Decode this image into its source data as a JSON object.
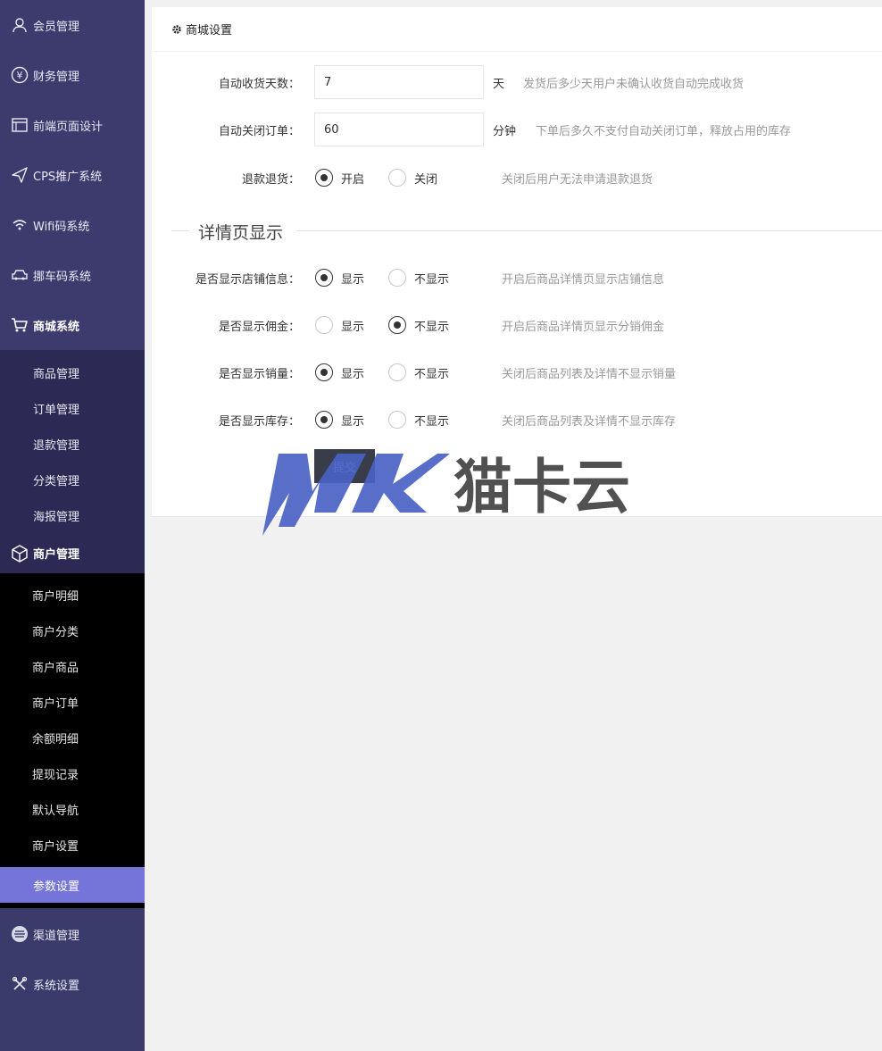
{
  "sidebar": {
    "top_items": [
      {
        "label": "会员管理",
        "icon": "user-icon"
      },
      {
        "label": "财务管理",
        "icon": "yen-icon"
      },
      {
        "label": "前端页面设计",
        "icon": "layout-icon"
      },
      {
        "label": "CPS推广系统",
        "icon": "send-icon"
      },
      {
        "label": "Wifi码系统",
        "icon": "wifi-icon"
      },
      {
        "label": "挪车码系统",
        "icon": "car-icon"
      },
      {
        "label": "商城系统",
        "icon": "cart-icon"
      }
    ],
    "shop_sub_items": [
      "商品管理",
      "订单管理",
      "退款管理",
      "分类管理",
      "海报管理"
    ],
    "merchant_header": {
      "label": "商户管理",
      "icon": "box-icon"
    },
    "merchant_sub_items": [
      "商户明细",
      "商户分类",
      "商户商品",
      "商户订单",
      "余额明细",
      "提现记录",
      "默认导航",
      "商户设置"
    ],
    "selected_item": "参数设置",
    "bottom_items": [
      {
        "label": "渠道管理",
        "icon": "menu-circle-icon"
      },
      {
        "label": "系统设置",
        "icon": "tools-icon"
      }
    ]
  },
  "panel": {
    "title": "商城设置",
    "title_icon": "gear-icon",
    "auto_receive": {
      "label": "自动收货天数：",
      "value": "7",
      "unit": "天",
      "hint": "发货后多少天用户未确认收货自动完成收货"
    },
    "auto_close": {
      "label": "自动关闭订单：",
      "value": "60",
      "unit": "分钟",
      "hint": "下单后多久不支付自动关闭订单，释放占用的库存"
    },
    "refund": {
      "label": "退款退货：",
      "options": [
        "开启",
        "关闭"
      ],
      "selected": 0,
      "hint": "关闭后用户无法申请退款退货"
    },
    "section_title": "详情页显示",
    "show_store": {
      "label": "是否显示店铺信息：",
      "options": [
        "显示",
        "不显示"
      ],
      "selected": 0,
      "hint": "开启后商品详情页显示店铺信息"
    },
    "show_commission": {
      "label": "是否显示佣金：",
      "options": [
        "显示",
        "不显示"
      ],
      "selected": 1,
      "hint": "开启后商品详情页显示分销佣金"
    },
    "show_sales": {
      "label": "是否显示销量：",
      "options": [
        "显示",
        "不显示"
      ],
      "selected": 0,
      "hint": "关闭后商品列表及详情不显示销量"
    },
    "show_stock": {
      "label": "是否显示库存：",
      "options": [
        "显示",
        "不显示"
      ],
      "selected": 0,
      "hint": "关闭后商品列表及详情不显示库存"
    },
    "submit_label": "提交"
  },
  "watermark": {
    "logo": "MK",
    "text": "猫卡云"
  },
  "colors": {
    "sidebar": "#3a3a6b",
    "sidebar_sub": "#2c2a55",
    "merchant_sub": "#000000",
    "selected": "#7575d9",
    "button": "#393d49",
    "watermark_blue": "#4a62c4"
  }
}
